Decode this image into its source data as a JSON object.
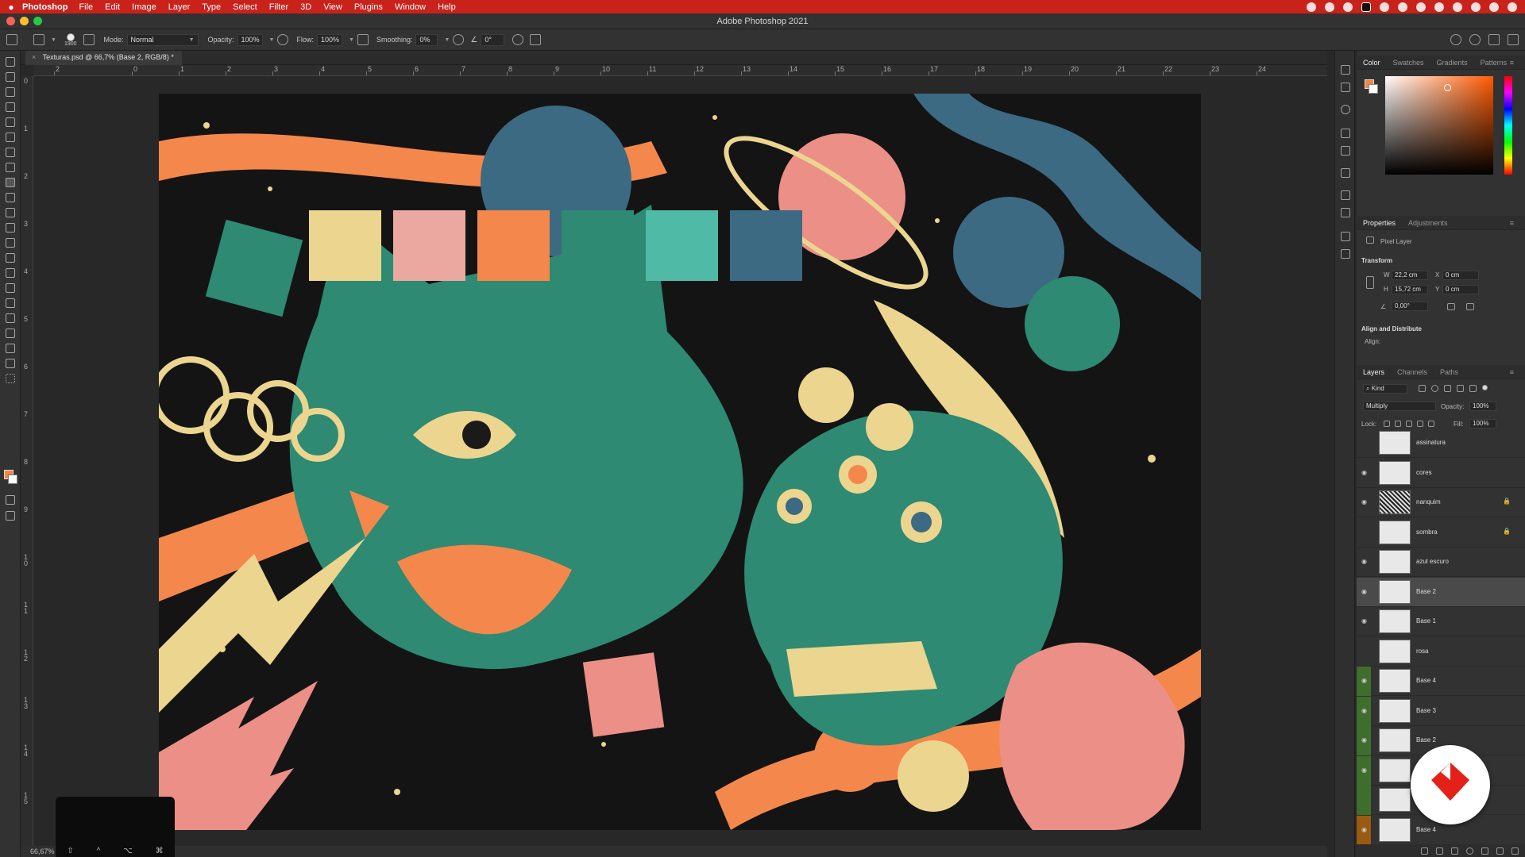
{
  "menubar": {
    "apple": "",
    "app_name": "Photoshop",
    "items": [
      "File",
      "Edit",
      "Image",
      "Layer",
      "Type",
      "Select",
      "Filter",
      "3D",
      "View",
      "Plugins",
      "Window",
      "Help"
    ],
    "bg_color": "#c8221b"
  },
  "window": {
    "title": "Adobe Photoshop 2021"
  },
  "options_bar": {
    "brush_size": "1900",
    "mode_label": "Mode:",
    "mode_value": "Normal",
    "opacity_label": "Opacity:",
    "opacity_value": "100%",
    "flow_label": "Flow:",
    "flow_value": "100%",
    "smoothing_label": "Smoothing:",
    "smoothing_value": "0%",
    "angle_value": "0°"
  },
  "document": {
    "tab_label": "Texturas.psd @ 66,7% (Base 2, RGB/8) *",
    "zoom": "66,67%"
  },
  "ruler": {
    "h_labels": [
      "2",
      "0",
      "1",
      "2",
      "3",
      "4",
      "5",
      "6",
      "7",
      "8",
      "9",
      "10",
      "11",
      "12",
      "13",
      "14",
      "15",
      "16",
      "17",
      "18",
      "19",
      "20",
      "21",
      "22",
      "23",
      "24"
    ],
    "v_labels": [
      "0",
      "1",
      "2",
      "3",
      "4",
      "5",
      "6",
      "7",
      "8",
      "9",
      "1\n0",
      "1\n1",
      "1\n2",
      "1\n3",
      "1\n4",
      "1\n5"
    ]
  },
  "palette_swatches": [
    "#ecd58f",
    "#eba8a0",
    "#f4874b",
    "#2e8a72",
    "#4fbaa6",
    "#3b6a82"
  ],
  "touchbar_keys": [
    "⇧",
    "^",
    "⌥",
    "⌘"
  ],
  "color_panel": {
    "tabs": [
      "Color",
      "Swatches",
      "Gradients",
      "Patterns"
    ],
    "foreground": "#f4863f",
    "background": "#ffffff"
  },
  "properties_panel": {
    "tabs": [
      "Properties",
      "Adjustments"
    ],
    "kind": "Pixel Layer",
    "transform_label": "Transform",
    "w_label": "W",
    "w_value": "22,2 cm",
    "x_label": "X",
    "x_value": "0 cm",
    "h_label": "H",
    "h_value": "15,72 cm",
    "y_label": "Y",
    "y_value": "0 cm",
    "angle_value": "0,00°",
    "align_label": "Align and Distribute",
    "align_sub": "Align:"
  },
  "layers_panel": {
    "tabs": [
      "Layers",
      "Channels",
      "Paths"
    ],
    "filter_label": "Kind",
    "blend_mode": "Multiply",
    "opacity_label": "Opacity:",
    "opacity_value": "100%",
    "lock_label": "Lock:",
    "fill_label": "Fill:",
    "fill_value": "100%",
    "layers": [
      {
        "name": "assinatura",
        "visible": false,
        "locked": false,
        "selected": false
      },
      {
        "name": "cores",
        "visible": true,
        "locked": false,
        "selected": false
      },
      {
        "name": "nanquim",
        "visible": true,
        "locked": true,
        "selected": false
      },
      {
        "name": "sombra",
        "visible": false,
        "locked": true,
        "selected": false
      },
      {
        "name": "azul escuro",
        "visible": true,
        "locked": false,
        "selected": false
      },
      {
        "name": "Base 2",
        "visible": true,
        "locked": false,
        "selected": true
      },
      {
        "name": "Base 1",
        "visible": true,
        "locked": false,
        "selected": false
      },
      {
        "name": "rosa",
        "visible": false,
        "locked": false,
        "selected": false
      },
      {
        "name": "Base 4",
        "visible": true,
        "locked": false,
        "selected": false
      },
      {
        "name": "Base 3",
        "visible": true,
        "locked": false,
        "selected": false
      },
      {
        "name": "Base 2",
        "visible": true,
        "locked": false,
        "selected": false
      },
      {
        "name": "",
        "visible": true,
        "locked": false,
        "selected": false
      },
      {
        "name": "",
        "visible": false,
        "locked": false,
        "selected": false
      },
      {
        "name": "Base 4",
        "visible": true,
        "locked": false,
        "selected": false
      }
    ]
  }
}
